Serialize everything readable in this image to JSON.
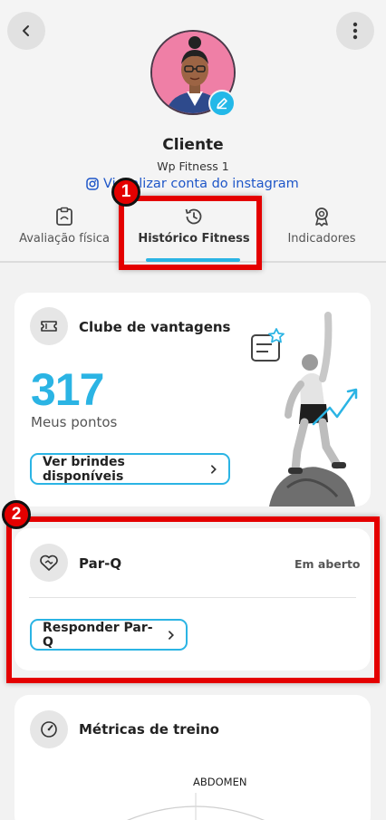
{
  "header": {
    "client_name": "Cliente",
    "client_subtitle": "Wp Fitness 1",
    "instagram_link": "Visualizar conta do instagram"
  },
  "tabs": [
    {
      "label": "Avaliação física",
      "icon": "clipboard-icon"
    },
    {
      "label": "Histórico Fitness",
      "icon": "history-icon",
      "active": true
    },
    {
      "label": "Indicadores",
      "icon": "award-icon"
    }
  ],
  "annotations": {
    "step1": "1",
    "step2": "2"
  },
  "club": {
    "title": "Clube de vantagens",
    "points": "317",
    "points_label": "Meus pontos",
    "button": "Ver brindes disponíveis"
  },
  "parq": {
    "title": "Par-Q",
    "status": "Em aberto",
    "button": "Responder Par-Q"
  },
  "metrics": {
    "title": "Métricas de treino",
    "axis_label": "ABDOMEN"
  },
  "colors": {
    "accent": "#2bb4e4",
    "highlight": "#e40000",
    "link": "#1e56c8"
  }
}
